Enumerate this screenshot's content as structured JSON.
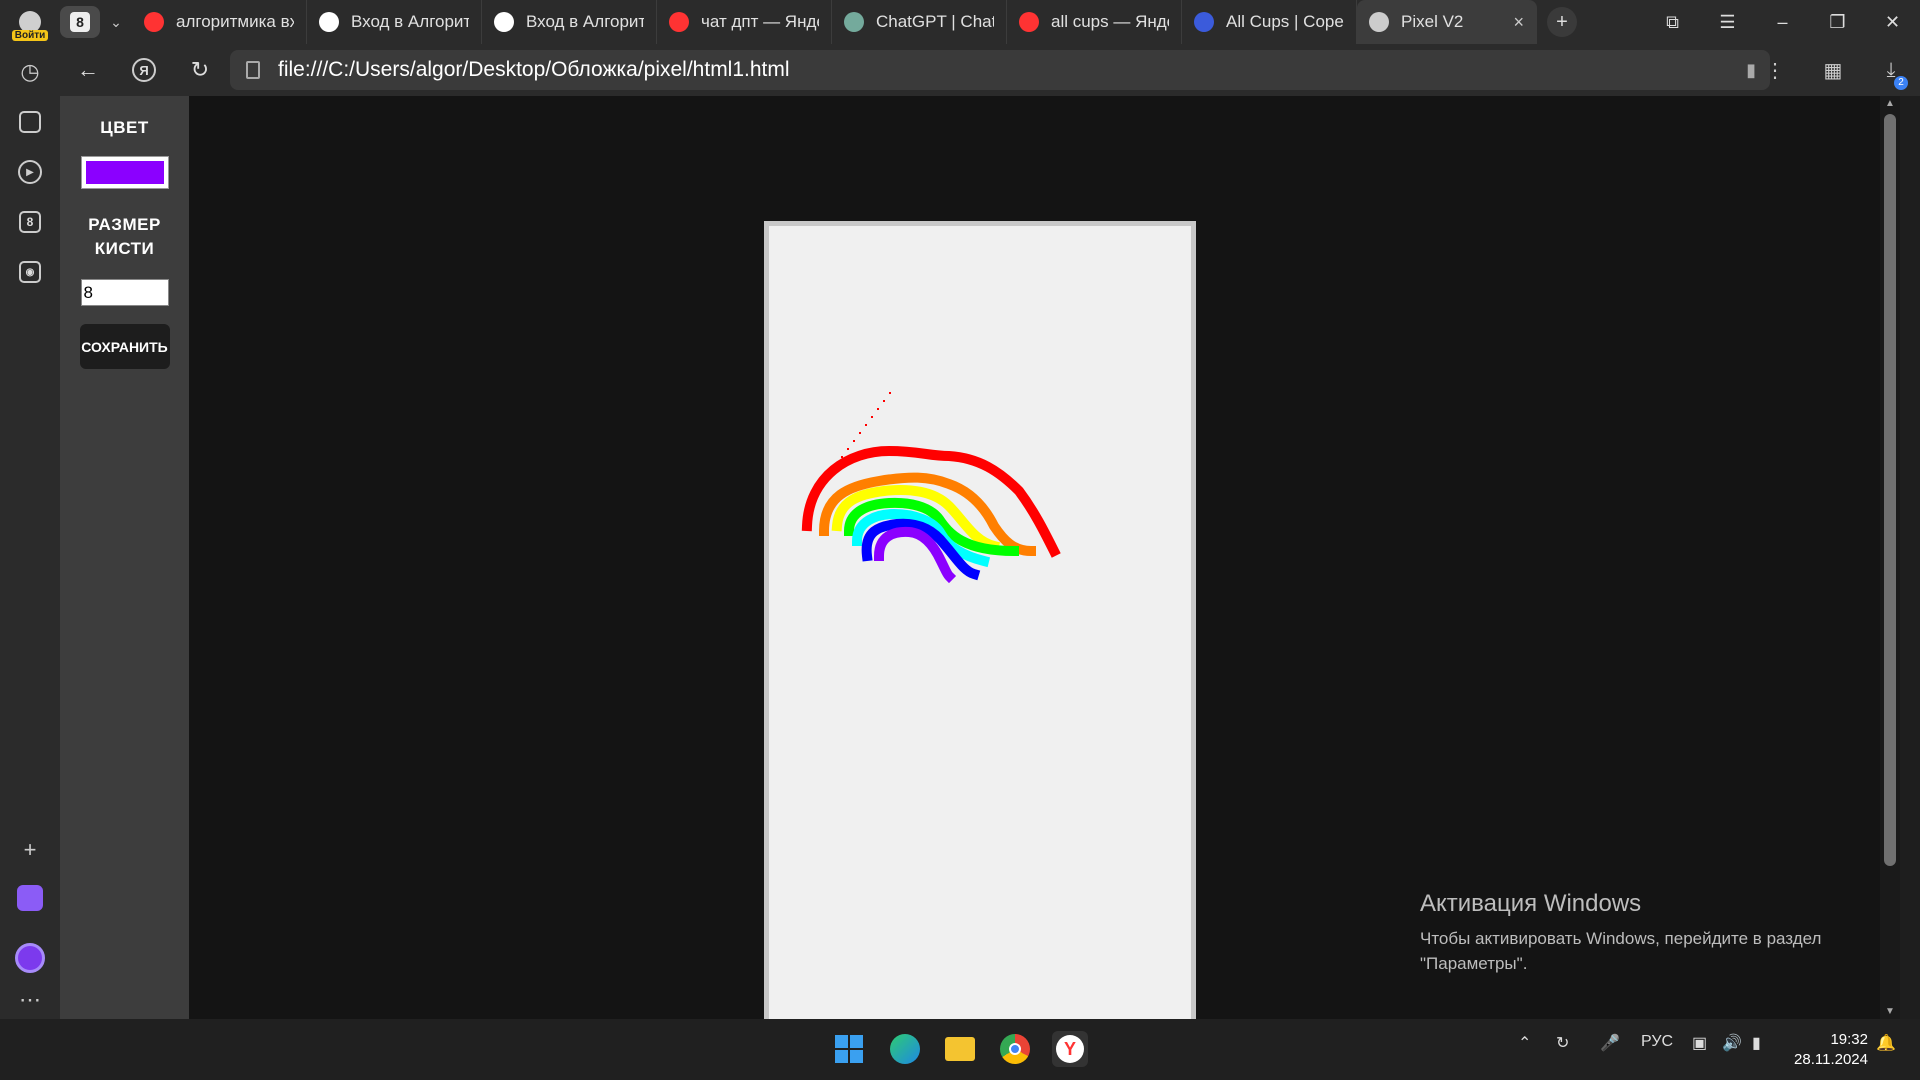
{
  "browser": {
    "profile_label": "Войти",
    "tab_group_count": "8",
    "tabs": [
      {
        "title": "алгоритмика вх",
        "icon": "yandex-icon",
        "color": "#ff3333"
      },
      {
        "title": "Вход в Алгорит",
        "icon": "algorithmika-icon",
        "color": "#ffffff"
      },
      {
        "title": "Вход в Алгорит",
        "icon": "algorithmika-icon",
        "color": "#ffffff"
      },
      {
        "title": "чат дпт — Янде",
        "icon": "yandex-icon",
        "color": "#ff3333"
      },
      {
        "title": "ChatGPT | Chat",
        "icon": "chatgpt-icon",
        "color": "#74aa9c"
      },
      {
        "title": "all cups — Янде",
        "icon": "yandex-icon",
        "color": "#ff3333"
      },
      {
        "title": "All Cups | Сорев",
        "icon": "allcups-icon",
        "color": "#3b5bdb"
      },
      {
        "title": "Pixel V2",
        "icon": "file-icon",
        "color": "#cccccc",
        "active": true
      }
    ],
    "url": "file:///C:/Users/algor/Desktop/Обложка/pixel/html1.html",
    "downloads_badge": "2"
  },
  "sidebar": {
    "tabs_badge": "8"
  },
  "app": {
    "color_label": "ЦВЕТ",
    "color_value": "#8b00ff",
    "brush_label_line1": "РАЗМЕР",
    "brush_label_line2": "КИСТИ",
    "brush_size": "8",
    "save_label": "СОХРАНИТЬ",
    "rainbow_colors": [
      "#ff0000",
      "#ff7f00",
      "#ffff00",
      "#00ff00",
      "#00ffff",
      "#0000ff",
      "#8b00ff"
    ]
  },
  "watermark": {
    "title": "Активация Windows",
    "line1": "Чтобы активировать Windows, перейдите в раздел",
    "line2": "\"Параметры\"."
  },
  "taskbar": {
    "language": "РУС",
    "time": "19:32",
    "date": "28.11.2024"
  }
}
